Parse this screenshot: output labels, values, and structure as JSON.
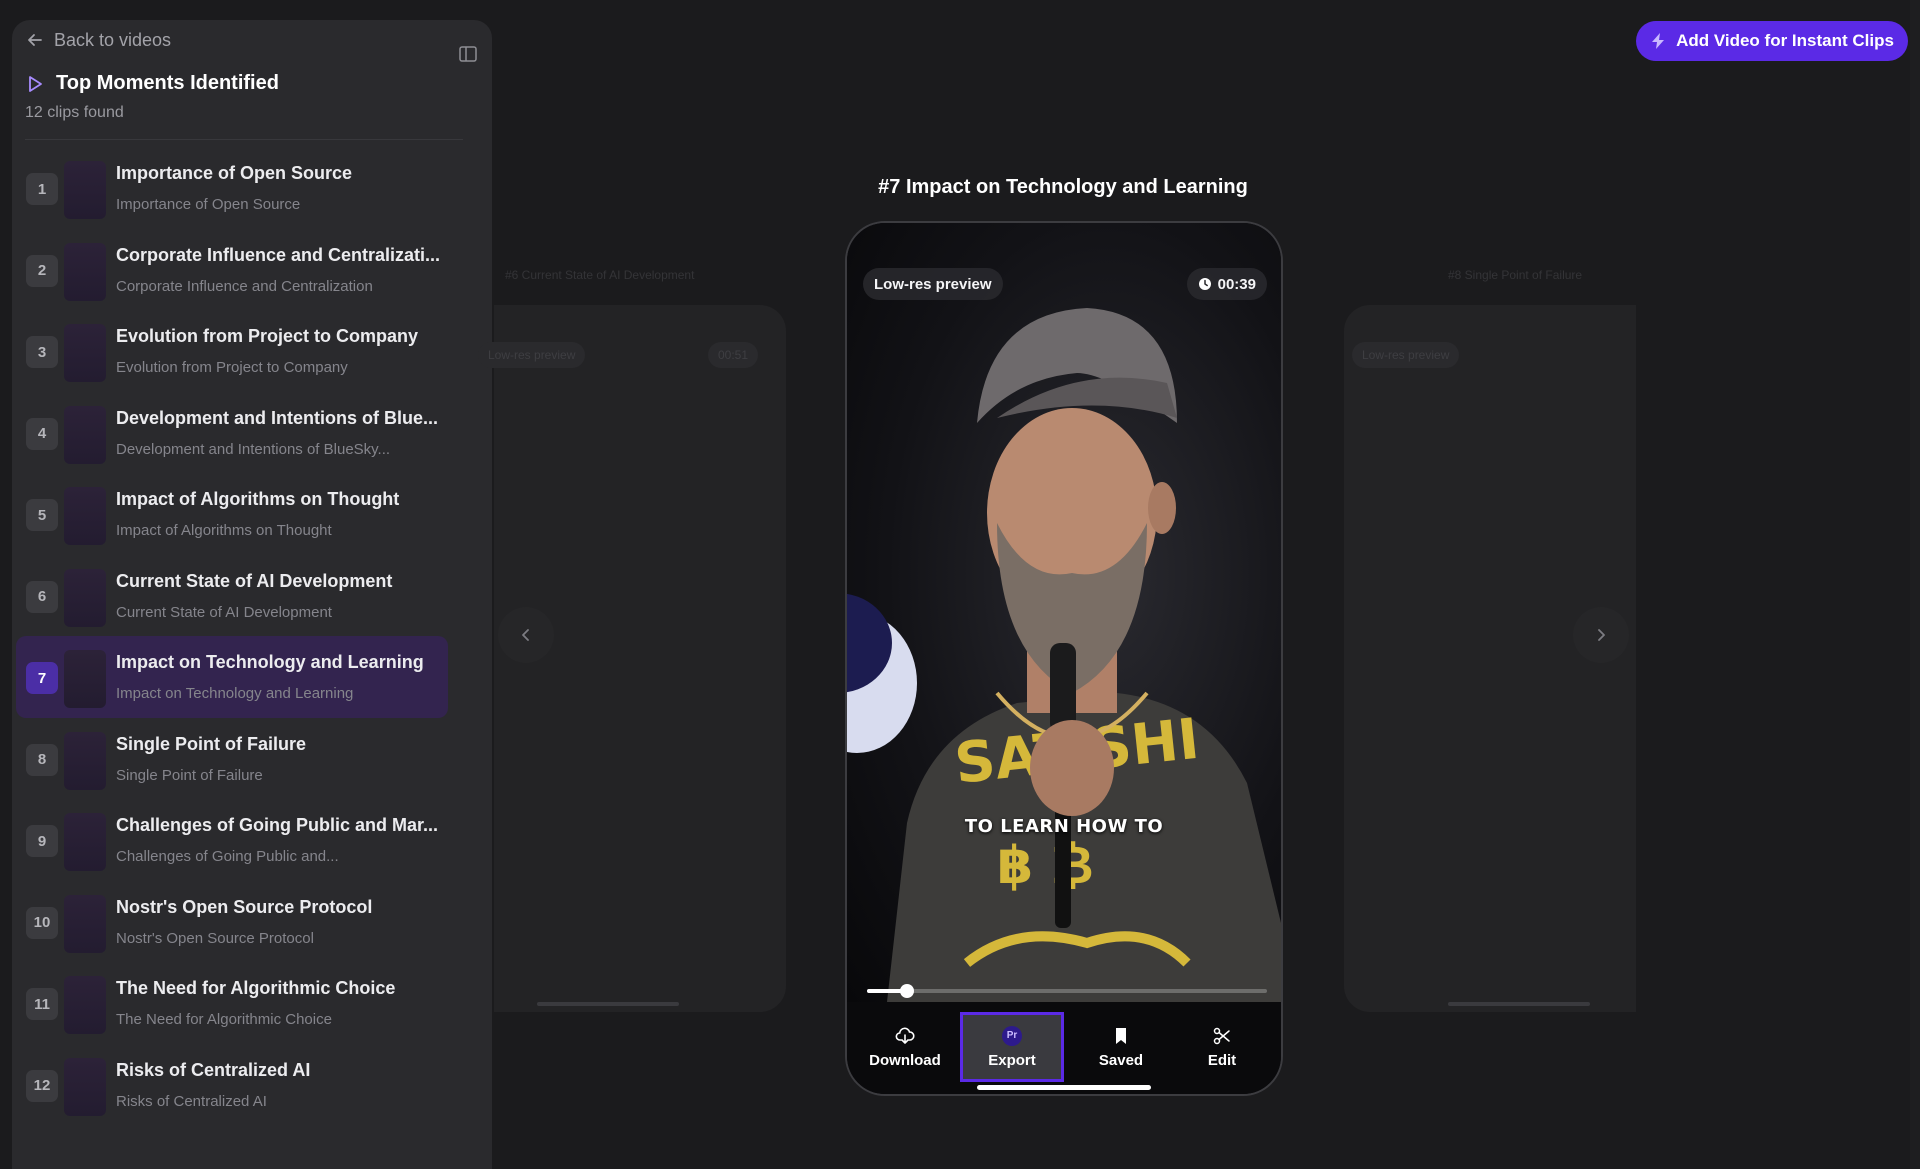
{
  "sidebar": {
    "back_label": "Back to videos",
    "title": "Top Moments Identified",
    "count": "12 clips found",
    "items": [
      {
        "num": "1",
        "title": "Importance of Open Source",
        "sub": "Importance of Open Source"
      },
      {
        "num": "2",
        "title": "Corporate Influence and Centralizati...",
        "sub": "Corporate Influence and Centralization"
      },
      {
        "num": "3",
        "title": "Evolution from Project to Company",
        "sub": "Evolution from Project to Company"
      },
      {
        "num": "4",
        "title": "Development and Intentions of Blue...",
        "sub": "Development and Intentions of BlueSky..."
      },
      {
        "num": "5",
        "title": "Impact of Algorithms on Thought",
        "sub": "Impact of Algorithms on Thought"
      },
      {
        "num": "6",
        "title": "Current State of AI Development",
        "sub": "Current State of AI Development"
      },
      {
        "num": "7",
        "title": "Impact on Technology and Learning",
        "sub": "Impact on Technology and Learning"
      },
      {
        "num": "8",
        "title": "Single Point of Failure",
        "sub": "Single Point of Failure"
      },
      {
        "num": "9",
        "title": "Challenges of Going Public and Mar...",
        "sub": "Challenges of Going Public and..."
      },
      {
        "num": "10",
        "title": "Nostr's Open Source Protocol",
        "sub": "Nostr's Open Source Protocol"
      },
      {
        "num": "11",
        "title": "The Need for Algorithmic Choice",
        "sub": "The Need for Algorithmic Choice"
      },
      {
        "num": "12",
        "title": "Risks of Centralized AI",
        "sub": "Risks of Centralized AI"
      }
    ],
    "active_index": 6
  },
  "header": {
    "add_button_label": "Add Video for Instant Clips"
  },
  "preview": {
    "heading": "#7 Impact on Technology and Learning",
    "badge_label": "Low-res preview",
    "duration": "00:39",
    "caption": "TO LEARN HOW TO",
    "progress": 0.1,
    "actions": {
      "download": "Download",
      "export": "Export",
      "export_badge": "Pr",
      "saved": "Saved",
      "edit": "Edit"
    }
  },
  "ghost_left": {
    "heading": "#6 Current State of AI Development",
    "badge_label": "Low-res preview",
    "duration": "00:51"
  },
  "ghost_right": {
    "heading": "#8 Single Point of Failure",
    "badge_label": "Low-res preview"
  },
  "colors": {
    "accent": "#5b2ae6",
    "active_row": "#33244f",
    "background": "#1b1b1d",
    "sidebar": "#2a2a2d"
  }
}
